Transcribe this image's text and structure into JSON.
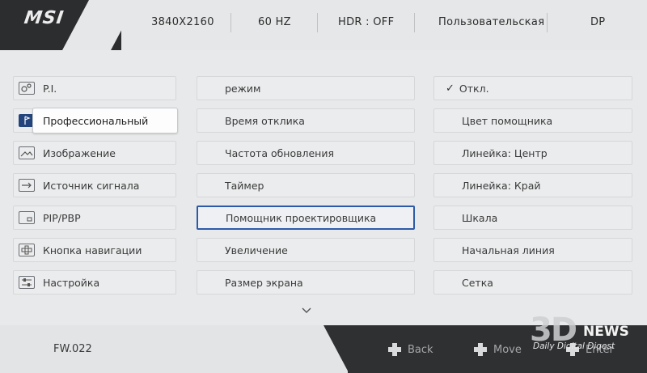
{
  "header": {
    "brand": "MSI",
    "resolution": "3840X2160",
    "refresh": "60 HZ",
    "hdr": "HDR : OFF",
    "profile": "Пользовательская",
    "input": "DP"
  },
  "main_menu": {
    "items": [
      {
        "label": "P.I.",
        "icon": "pi-icon"
      },
      {
        "label": "Профессиональный",
        "icon": "flag-icon"
      },
      {
        "label": "Изображение",
        "icon": "image-icon"
      },
      {
        "label": "Источник сигнала",
        "icon": "input-source-icon"
      },
      {
        "label": "PIP/PBP",
        "icon": "pip-icon"
      },
      {
        "label": "Кнопка навигации",
        "icon": "navigation-key-icon"
      },
      {
        "label": "Настройка",
        "icon": "settings-icon"
      }
    ],
    "selected_index": 1
  },
  "sub_menu": {
    "items": [
      "режим",
      "Время отклика",
      "Частота обновления",
      "Таймер",
      "Помощник проектировщика",
      "Увеличение",
      "Размер экрана"
    ],
    "focused_index": 4
  },
  "options": {
    "items": [
      "Откл.",
      "Цвет помощника",
      "Линейка: Центр",
      "Линейка: Край",
      "Шкала",
      "Начальная линия",
      "Сетка"
    ],
    "checked_index": 0
  },
  "footer": {
    "firmware": "FW.022",
    "back_label": "Back",
    "move_label": "Move",
    "enter_label": "Enter"
  },
  "watermark": {
    "logo": "3D",
    "news": "NEWS",
    "tagline": "Daily Digital Digest"
  },
  "colors": {
    "accent": "#2d5aa8",
    "panel": "#e8e9ea",
    "dark": "#2c2d2f"
  }
}
